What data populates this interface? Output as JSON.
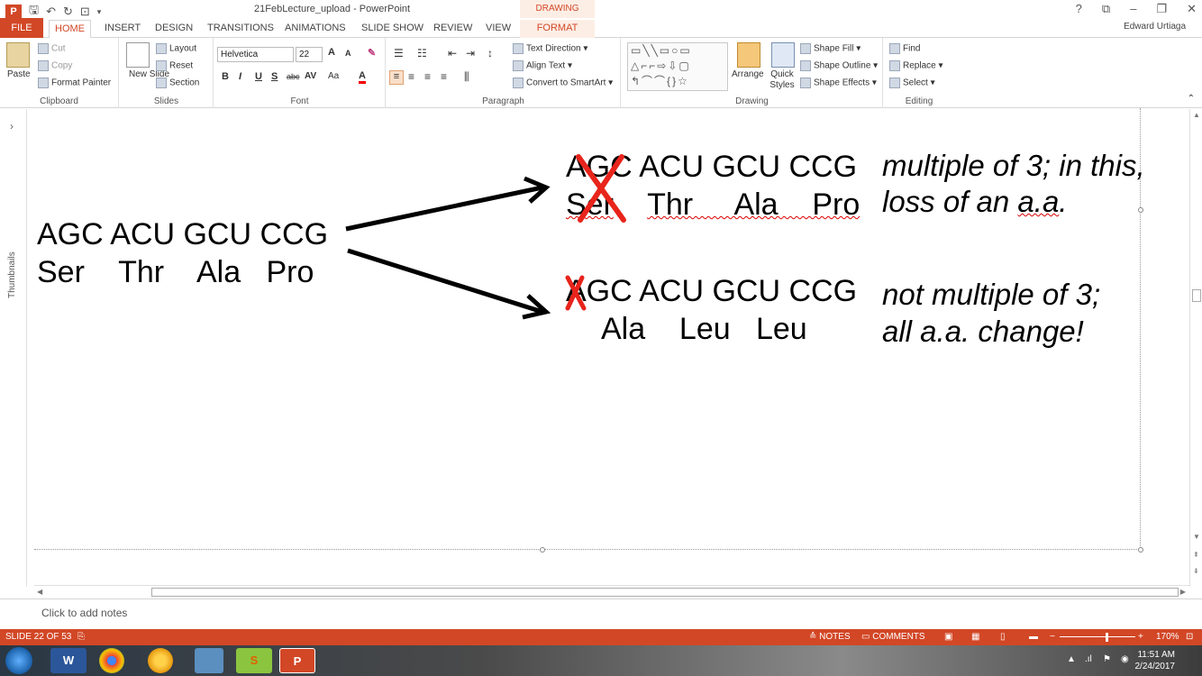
{
  "app": {
    "window_title": "21FebLecture_upload - PowerPoint",
    "contextual_tab_group": "DRAWING TOOLS",
    "user_name": "Edward Urtiaga",
    "accent_color": "#d24726"
  },
  "title_bar": {
    "help": "?"
  },
  "tabs": [
    {
      "label": "FILE"
    },
    {
      "label": "HOME"
    },
    {
      "label": "INSERT"
    },
    {
      "label": "DESIGN"
    },
    {
      "label": "TRANSITIONS"
    },
    {
      "label": "ANIMATIONS"
    },
    {
      "label": "SLIDE SHOW"
    },
    {
      "label": "REVIEW"
    },
    {
      "label": "VIEW"
    },
    {
      "label": "FORMAT"
    }
  ],
  "ribbon": {
    "clipboard": {
      "label": "Clipboard",
      "paste": "Paste",
      "cut": "Cut",
      "copy": "Copy",
      "format_painter": "Format Painter"
    },
    "slides": {
      "label": "Slides",
      "new_slide": "New Slide",
      "layout": "Layout",
      "reset": "Reset",
      "section": "Section"
    },
    "font": {
      "label": "Font",
      "font_name": "Helvetica",
      "font_size": "22",
      "bold": "B",
      "italic": "I",
      "underline": "U",
      "shadow": "S",
      "strike": "abc",
      "spacing": "AV",
      "change_case": "Aa",
      "font_color": "A",
      "grow": "A",
      "shrink": "A"
    },
    "paragraph": {
      "label": "Paragraph",
      "text_direction": "Text Direction",
      "align_text": "Align Text",
      "convert_smartart": "Convert to SmartArt"
    },
    "drawing": {
      "label": "Drawing",
      "arrange": "Arrange",
      "quick_styles": "Quick Styles",
      "shape_fill": "Shape Fill",
      "shape_outline": "Shape Outline",
      "shape_effects": "Shape Effects",
      "shapes_row1": "▭╲╲▭○▭",
      "shapes_row2": "△⌐⌐⇨⇩▢",
      "shapes_row3": "↰⌒⌒{}☆"
    },
    "editing": {
      "label": "Editing",
      "find": "Find",
      "replace": "Replace",
      "select": "Select"
    }
  },
  "thumbnails_pane": {
    "label": "Thumbnails",
    "expand_glyph": "›"
  },
  "slide": {
    "original": {
      "codons": "AGC ACU GCU CCG",
      "amino_acids": "Ser    Thr    Ala   Pro"
    },
    "mutation_top": {
      "codons": "AGC ACU GCU CCG",
      "amino_acids_first": "Ser",
      "amino_acids_rest": "Thr     Ala    Pro",
      "note_line1": "multiple of 3; in this,",
      "note_line2_prefix": "loss of an ",
      "note_line2_squiggle": "a.a",
      "note_line2_suffix": "."
    },
    "mutation_bottom": {
      "codons": "AGC ACU GCU CCG",
      "amino_acids": "Ala    Leu   Leu",
      "note_line1": "not multiple of 3;",
      "note_line2": "all a.a. change!"
    },
    "strike_color": "#e8241b"
  },
  "notes": {
    "placeholder": "Click to add notes"
  },
  "status_bar": {
    "slide_info": "SLIDE 22 OF 53",
    "notes_button": "NOTES",
    "comments_button": "COMMENTS",
    "zoom_level": "170%",
    "zoom_minus": "−",
    "zoom_plus": "+"
  },
  "taskbar": {
    "time": "11:51 AM",
    "date": "2/24/2017"
  }
}
